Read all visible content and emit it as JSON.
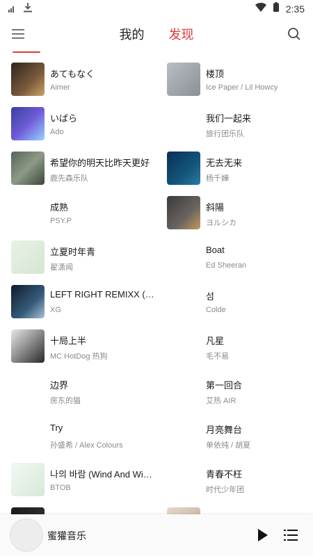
{
  "status": {
    "time": "2:35"
  },
  "tabs": [
    {
      "label": "我的",
      "active": false
    },
    {
      "label": "发现",
      "active": true
    }
  ],
  "accent_color": "#e0383b",
  "left_column": [
    {
      "title": "あてもなく",
      "artist": "Aimer",
      "has_cover": true
    },
    {
      "title": "いばら",
      "artist": "Ado",
      "has_cover": true
    },
    {
      "title": "希望你的明天比昨天更好",
      "artist": "鹿先森乐队",
      "has_cover": true
    },
    {
      "title": "成熟",
      "artist": "PSY.P",
      "has_cover": false
    },
    {
      "title": "立夏时年青",
      "artist": "翟潇闻",
      "has_cover": true
    },
    {
      "title": "LEFT RIGHT REMIXX (Remix)",
      "artist": "XG",
      "has_cover": true
    },
    {
      "title": "十局上半",
      "artist": "MC HotDog 热狗",
      "has_cover": true
    },
    {
      "title": "边界",
      "artist": "房东的猫",
      "has_cover": false
    },
    {
      "title": "Try",
      "artist": "孙盛希 / Alex Colours",
      "has_cover": false
    },
    {
      "title": "나의 바람 (Wind And Wish)",
      "artist": "BTOB",
      "has_cover": true
    }
  ],
  "right_column": [
    {
      "title": "楼顶",
      "artist": "Ice Paper / Lil Howcy",
      "has_cover": true
    },
    {
      "title": "我们一起来",
      "artist": "旅行团乐队",
      "has_cover": false
    },
    {
      "title": "无去无来",
      "artist": "杨千嬅",
      "has_cover": true
    },
    {
      "title": "斜陽",
      "artist": "ヨルシカ",
      "has_cover": true
    },
    {
      "title": "Boat",
      "artist": "Ed Sheeran",
      "has_cover": false
    },
    {
      "title": "섬",
      "artist": "Colde",
      "has_cover": false
    },
    {
      "title": "凡星",
      "artist": "毛不易",
      "has_cover": false
    },
    {
      "title": "第一回合",
      "artist": "艾热 AIR",
      "has_cover": false
    },
    {
      "title": "月亮舞台",
      "artist": "单依纯 / 胡夏",
      "has_cover": false
    },
    {
      "title": "青春不枉",
      "artist": "时代少年团",
      "has_cover": false
    }
  ],
  "player": {
    "name": "蜜獾音乐"
  }
}
